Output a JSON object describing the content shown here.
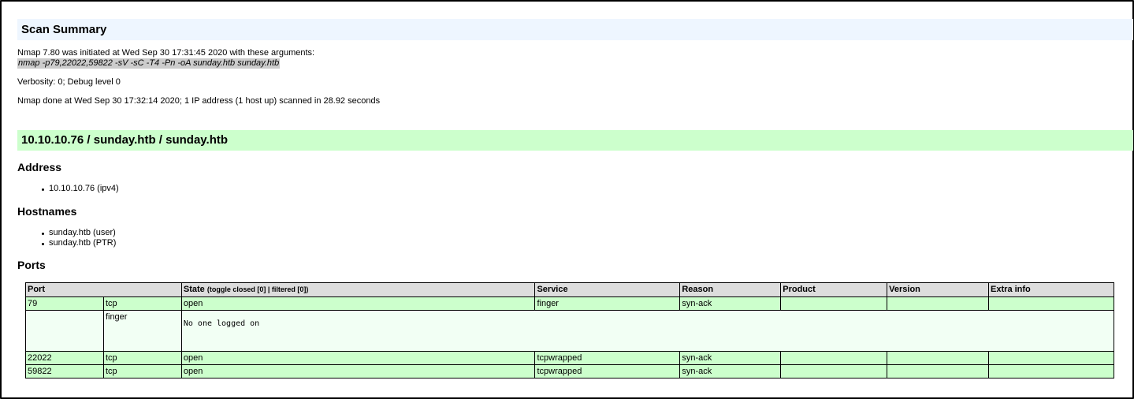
{
  "scan_summary": {
    "title": "Scan Summary",
    "initiated_text": "Nmap 7.80 was initiated at Wed Sep 30 17:31:45 2020 with these arguments:",
    "command": "nmap -p79,22022,59822 -sV -sC -T4 -Pn -oA sunday.htb sunday.htb",
    "verbosity": "Verbosity: 0; Debug level 0",
    "done_text": "Nmap done at Wed Sep 30 17:32:14 2020; 1 IP address (1 host up) scanned in 28.92 seconds"
  },
  "host": {
    "title": "10.10.10.76 / sunday.htb / sunday.htb",
    "address_heading": "Address",
    "addresses": [
      "10.10.10.76 (ipv4)"
    ],
    "hostnames_heading": "Hostnames",
    "hostnames": [
      "sunday.htb (user)",
      "sunday.htb (PTR)"
    ],
    "ports_heading": "Ports"
  },
  "ports_table": {
    "headers": {
      "port": "Port",
      "state": "State",
      "toggle": "(toggle closed [0] | filtered [0])",
      "service": "Service",
      "reason": "Reason",
      "product": "Product",
      "version": "Version",
      "extra": "Extra info"
    },
    "rows": [
      {
        "port": "79",
        "proto": "tcp",
        "state": "open",
        "service": "finger",
        "reason": "syn-ack",
        "product": "",
        "version": "",
        "extra": ""
      },
      {
        "port": "22022",
        "proto": "tcp",
        "state": "open",
        "service": "tcpwrapped",
        "reason": "syn-ack",
        "product": "",
        "version": "",
        "extra": ""
      },
      {
        "port": "59822",
        "proto": "tcp",
        "state": "open",
        "service": "tcpwrapped",
        "reason": "syn-ack",
        "product": "",
        "version": "",
        "extra": ""
      }
    ],
    "script": {
      "name": "finger",
      "output": "No one logged on"
    }
  },
  "colors": {
    "summary_header_bg": "#eef6ff",
    "host_header_bg": "#ccffcc",
    "open_row_bg": "#ccffcc",
    "script_row_bg": "#f2fff4",
    "table_header_bg": "#dddddd"
  }
}
